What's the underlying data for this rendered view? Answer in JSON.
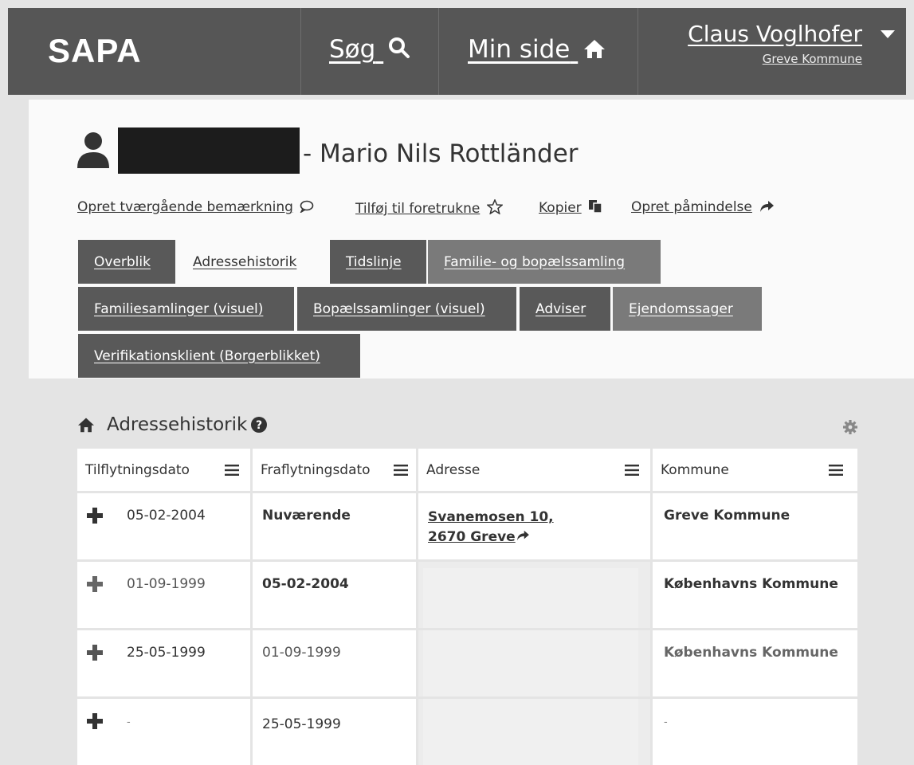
{
  "header": {
    "brand": "SAPA",
    "search_label": "Søg",
    "mypage_label": "Min side",
    "user_name": "Claus Voglhofer",
    "user_org": "Greve Kommune"
  },
  "person": {
    "name": "- Mario Nils Rottländer"
  },
  "actions": {
    "remark": "Opret tværgående bemærkning",
    "favorite": "Tilføj til foretrukne",
    "copy": "Kopier",
    "reminder": "Opret påmindelse"
  },
  "tabs": [
    {
      "label": "Overblik"
    },
    {
      "label": "Adressehistorik"
    },
    {
      "label": "Tidslinje"
    },
    {
      "label": "Familie- og bopælssamling"
    },
    {
      "label": "Familiesamlinger (visuel)"
    },
    {
      "label": "Bopælssamlinger (visuel)"
    },
    {
      "label": "Adviser"
    },
    {
      "label": "Ejendomssager"
    },
    {
      "label": "Verifikationsklient (Borgerblikket)"
    }
  ],
  "section": {
    "title": "Adressehistorik"
  },
  "table": {
    "columns": [
      "Tilflytningsdato",
      "Fraflytningsdato",
      "Adresse",
      "Kommune"
    ],
    "rows": [
      {
        "in": "05-02-2004",
        "out": "Nuværende",
        "addr1": "Svanemosen 10,",
        "addr2": "2670 Greve",
        "kommune": "Greve Kommune"
      },
      {
        "in": "01-09-1999",
        "out": "05-02-2004",
        "addr1": "",
        "addr2": "",
        "kommune": "Københavns Kommune"
      },
      {
        "in": "25-05-1999",
        "out": "01-09-1999",
        "addr1": "",
        "addr2": "",
        "kommune": "Københavns Kommune"
      },
      {
        "in": "-",
        "out": "25-05-1999",
        "addr1": "",
        "addr2": "",
        "kommune": "-"
      }
    ]
  }
}
